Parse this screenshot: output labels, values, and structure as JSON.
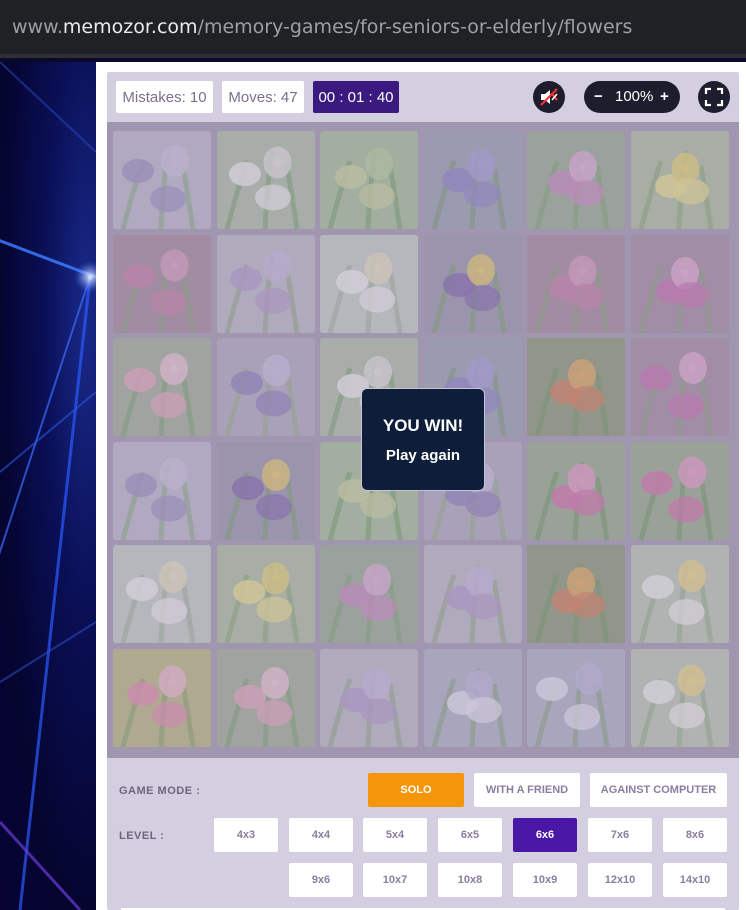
{
  "browser": {
    "url_prefix": "www.",
    "url_host": "memozor.com",
    "url_path": "/memory-games/for-seniors-or-elderly/flowers"
  },
  "status": {
    "mistakes": "Mistakes: 10",
    "moves": "Moves: 47",
    "timer": "00 : 01 : 40",
    "zoom": "100%",
    "zoom_minus": "−",
    "zoom_plus": "+"
  },
  "modal": {
    "title": "YOU WIN!",
    "action": "Play again"
  },
  "controls": {
    "mode_label": "GAME MODE :",
    "modes": [
      "SOLO",
      "WITH A FRIEND",
      "AGAINST COMPUTER"
    ],
    "level_label": "LEVEL :",
    "levels_row1": [
      "4x3",
      "4x4",
      "5x4",
      "6x5",
      "6x6",
      "7x6",
      "8x6"
    ],
    "levels_row2": [
      "9x6",
      "10x7",
      "10x8",
      "10x9",
      "12x10",
      "14x10"
    ]
  },
  "icons": {
    "sound": "speaker-muted-icon",
    "fullscreen": "fullscreen-icon"
  },
  "colors": {
    "timer_bg": "#3b1a7f",
    "solo_bg": "#f5960a",
    "active_level_bg": "#4a16a6",
    "modal_bg": "#0e1e3a"
  },
  "board": {
    "size": "6x6",
    "tiles": [
      "lavender",
      "white-lily",
      "daffodil-buds",
      "agapanthus",
      "foxglove",
      "daffodil",
      "pink-phlox",
      "liatris",
      "white-daisy",
      "pansy",
      "pink-phlox",
      "osteospermum",
      "water-lily",
      "lavender-field",
      "white-lily",
      "agapanthus",
      "marigold",
      "osteospermum",
      "lavender",
      "pansy",
      "daffodil-buds",
      "lavender-field",
      "calla-lily",
      "calla-lily",
      "white-daisy",
      "daffodil",
      "foxglove",
      "liatris",
      "marigold",
      "chamomile",
      "bleeding-heart",
      "water-lily",
      "liatris",
      "petunia",
      "petunia",
      "chamomile"
    ]
  }
}
